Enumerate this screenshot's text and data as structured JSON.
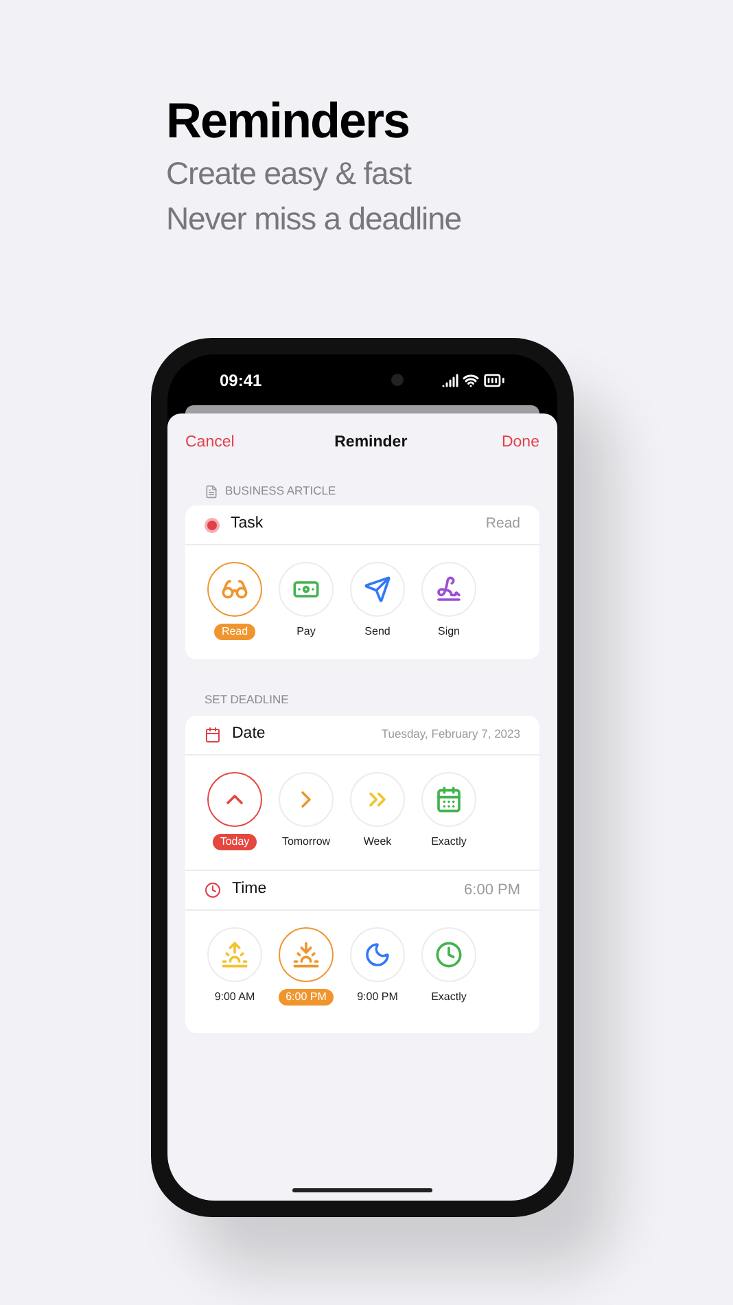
{
  "headline": {
    "title": "Reminders",
    "subtitle_lines": [
      "Create easy & fast",
      "Never miss a deadline"
    ]
  },
  "status_bar": {
    "time": "09:41"
  },
  "nav": {
    "cancel": "Cancel",
    "title": "Reminder",
    "done": "Done"
  },
  "task_section": {
    "header": "BUSINESS ARTICLE",
    "row_label": "Task",
    "row_value": "Read",
    "options": [
      {
        "label": "Read",
        "selected": true,
        "color": "#f0952e"
      },
      {
        "label": "Pay",
        "selected": false,
        "color": "#43b34f"
      },
      {
        "label": "Send",
        "selected": false,
        "color": "#3478f6"
      },
      {
        "label": "Sign",
        "selected": false,
        "color": "#9b4fd6"
      }
    ]
  },
  "deadline_section": {
    "header": "SET DEADLINE",
    "date_label": "Date",
    "date_value": "Tuesday, February 7, 2023",
    "date_options": [
      {
        "label": "Today",
        "selected": true,
        "color": "#e5473f"
      },
      {
        "label": "Tomorrow",
        "selected": false,
        "color": "#f0952e"
      },
      {
        "label": "Week",
        "selected": false,
        "color": "#f3c331"
      },
      {
        "label": "Exactly",
        "selected": false,
        "color": "#43b34f"
      }
    ],
    "time_label": "Time",
    "time_value": "6:00 PM",
    "time_options": [
      {
        "label": "9:00 AM",
        "selected": false,
        "color": "#f3c331"
      },
      {
        "label": "6:00 PM",
        "selected": true,
        "color": "#f0952e"
      },
      {
        "label": "9:00 PM",
        "selected": false,
        "color": "#3478f6"
      },
      {
        "label": "Exactly",
        "selected": false,
        "color": "#43b34f"
      }
    ]
  }
}
